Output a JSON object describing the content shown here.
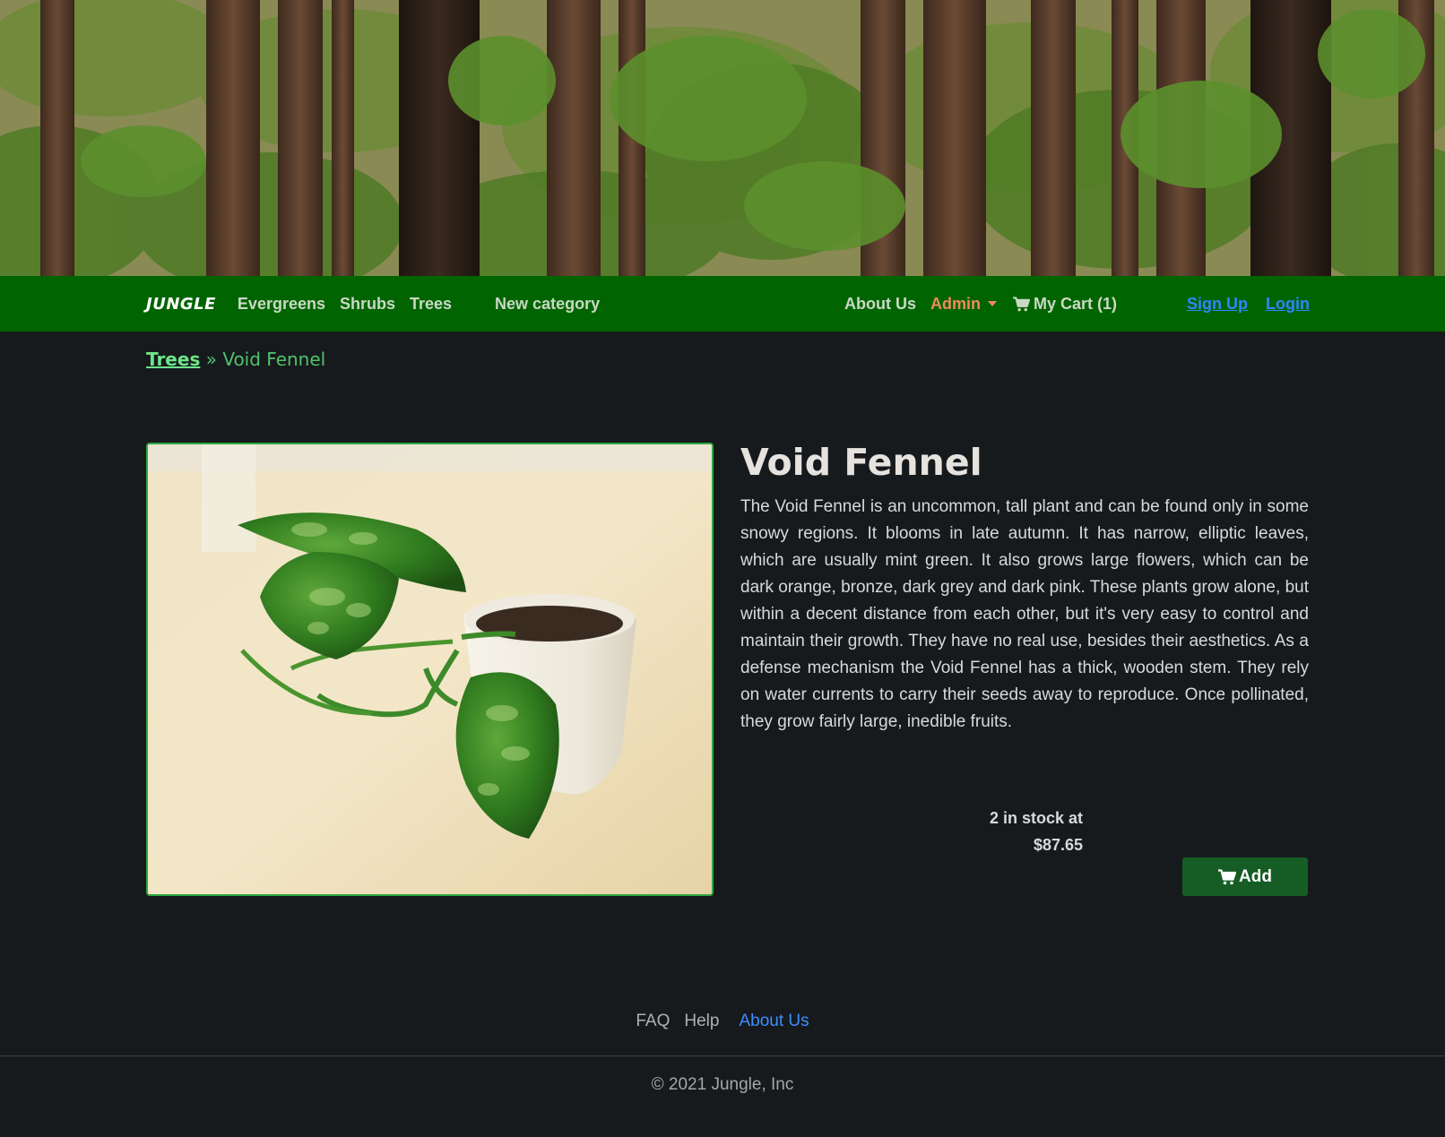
{
  "nav": {
    "brand": "JUNGLE",
    "categories": [
      "Evergreens",
      "Shrubs",
      "Trees"
    ],
    "new_category": "New category",
    "about": "About Us",
    "admin": "Admin",
    "cart": "My Cart (1)",
    "signup": "Sign Up",
    "login": "Login"
  },
  "breadcrumb": {
    "parent": "Trees",
    "separator": "»",
    "current": "Void Fennel"
  },
  "product": {
    "name": "Void Fennel",
    "description": "The Void Fennel is an uncommon, tall plant and can be found only in some snowy regions. It blooms in late autumn. It has narrow, elliptic leaves, which are usually mint green. It also grows large flowers, which can be dark orange, bronze, dark grey and dark pink. These plants grow alone, but within a decent distance from each other, but it's very easy to control and maintain their growth. They have no real use, besides their aesthetics. As a defense mechanism the Void Fennel has a thick, wooden stem. They rely on water currents to carry their seeds away to reproduce. Once pollinated, they grow fairly large, inedible fruits.",
    "stock_line": "2 in stock at",
    "price": "$87.65",
    "add_label": "Add"
  },
  "footer": {
    "faq": "FAQ",
    "help": "Help",
    "about": "About Us",
    "copyright": "© 2021 Jungle, Inc"
  },
  "colors": {
    "navbar": "#006400",
    "background": "#161a1d",
    "admin": "#f08a5d",
    "link": "#2e86ff",
    "add_button": "#155d24",
    "image_border": "#2ea83f"
  },
  "icons": {
    "cart": "shopping-cart-icon",
    "caret": "caret-down-icon"
  }
}
